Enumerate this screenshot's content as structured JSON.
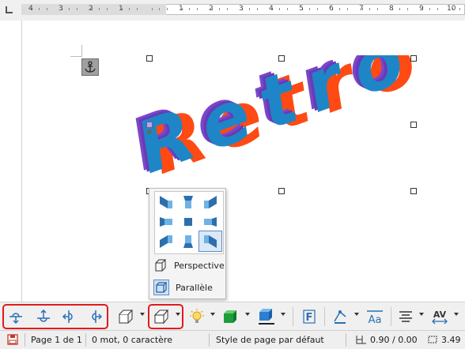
{
  "ruler": {
    "numbers": [
      "4",
      "3",
      "2",
      "1",
      "1",
      "2",
      "3",
      "4",
      "5",
      "6",
      "7",
      "8",
      "9",
      "10"
    ]
  },
  "fontwork": {
    "text": "Retro",
    "colors": {
      "face": "#1e86c6",
      "side": "#7a47c9",
      "shadow": "#ff4a14"
    }
  },
  "extrusion_popup": {
    "perspective_label": "Perspective",
    "parallel_label": "Parallèle"
  },
  "toolbar": {
    "icons": [
      "tilt-down-icon",
      "tilt-up-icon",
      "tilt-left-icon",
      "tilt-right-icon",
      "extrusion-toggle-icon",
      "extrusion-direction-icon",
      "lighting-icon",
      "surface-icon",
      "depth-icon",
      "fontwork-icon",
      "line-color-icon",
      "character-spacing-icon",
      "alignment-icon",
      "av-spacing-icon"
    ],
    "highlight_color": "#e01b1b"
  },
  "status": {
    "page": "Page 1 de 1",
    "words": "0 mot, 0 caractère",
    "page_style": "Style de page par défaut",
    "position": "0.90 / 0.00",
    "size": "3.49"
  }
}
